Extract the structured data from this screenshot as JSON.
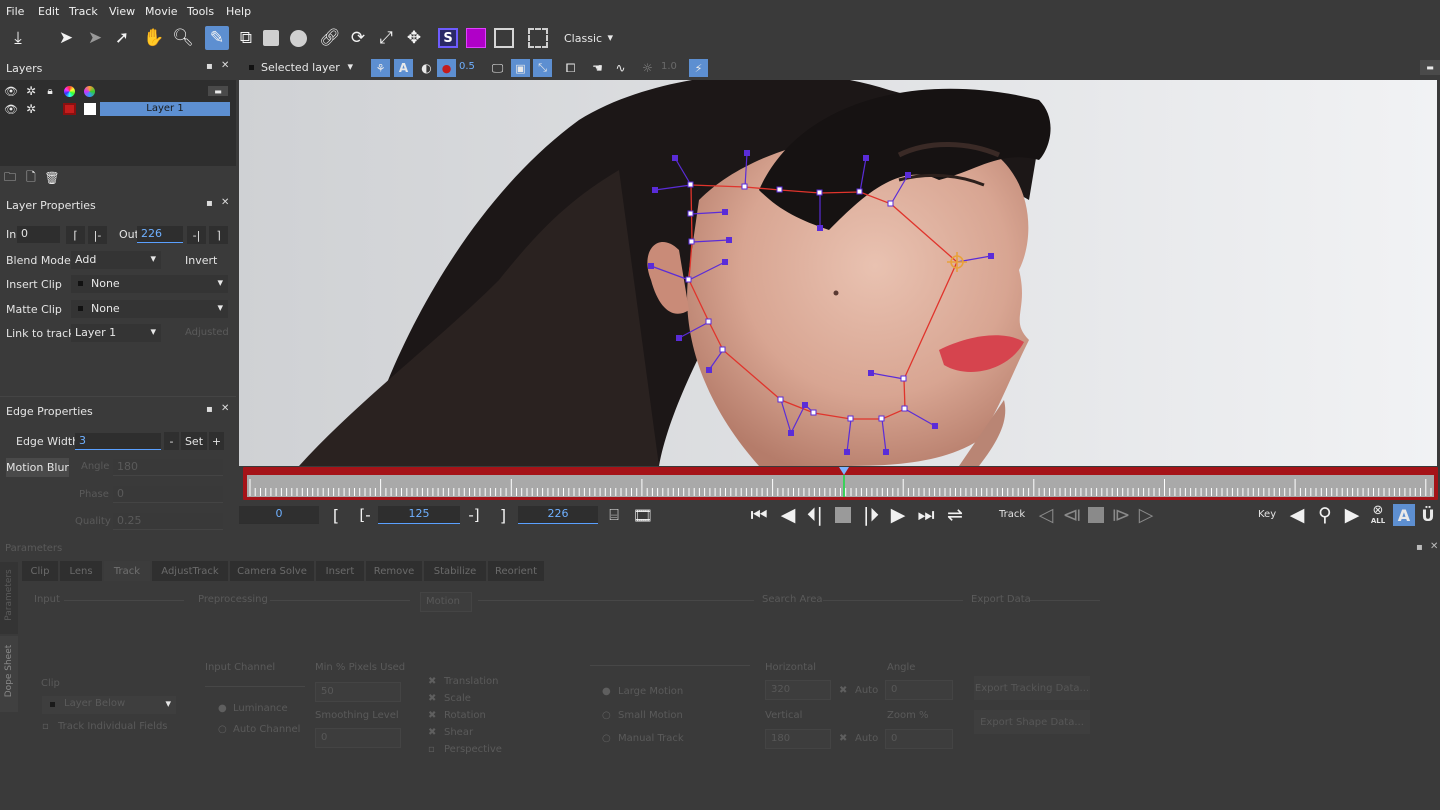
{
  "menu": [
    "File",
    "Edit",
    "Track",
    "View",
    "Movie",
    "Tools",
    "Help"
  ],
  "toolbar": {
    "classic_dropdown": "Classic",
    "selected_layer_dropdown": "Selected layer",
    "opacity_value": "0.5",
    "brightness_value": "1.0"
  },
  "layers_panel": {
    "title": "Layers",
    "layer1_name": "Layer 1"
  },
  "layer_properties": {
    "title": "Layer Properties",
    "in_label": "In",
    "in_value": "0",
    "out_label": "Out",
    "out_value": "226",
    "blend_mode_label": "Blend Mode",
    "blend_mode_value": "Add",
    "invert_label": "Invert",
    "insert_clip_label": "Insert Clip",
    "insert_clip_value": "None",
    "matte_clip_label": "Matte Clip",
    "matte_clip_value": "None",
    "link_to_track_label": "Link to track",
    "link_to_track_value": "Layer 1",
    "adjusted_label": "Adjusted"
  },
  "edge_properties": {
    "title": "Edge Properties",
    "edge_width_label": "Edge Width",
    "edge_width_value": "3",
    "minus": "-",
    "set": "Set",
    "plus": "+",
    "motion_blur_label": "Motion Blur",
    "angle_label": "Angle",
    "angle_value": "180",
    "phase_label": "Phase",
    "phase_value": "0",
    "quality_label": "Quality",
    "quality_value": "0.25"
  },
  "timeline": {
    "start_frame": "0",
    "in_frame": "125",
    "out_frame": "226",
    "playhead_fraction": 0.503,
    "track_label": "Track",
    "key_label": "Key",
    "all_label": "ALL"
  },
  "parameters": {
    "title": "Parameters",
    "side_tab_parameters": "Parameters",
    "side_tab_dope_sheet": "Dope Sheet",
    "tabs": [
      "Clip",
      "Lens",
      "Track",
      "AdjustTrack",
      "Camera Solve",
      "Insert",
      "Remove",
      "Stabilize",
      "Reorient"
    ],
    "active_tab": "Track",
    "input_header": "Input",
    "preprocessing_header": "Preprocessing",
    "motion_header": "Motion",
    "search_area_header": "Search Area",
    "export_data_header": "Export Data",
    "input_channel_label": "Input Channel",
    "luminance": "Luminance",
    "auto_channel": "Auto Channel",
    "clip_label": "Clip",
    "clip_value": "Layer Below",
    "track_individual_fields": "Track Individual Fields",
    "min_pixels_label": "Min % Pixels Used",
    "min_pixels_value": "50",
    "smoothing_label": "Smoothing Level",
    "smoothing_value": "0",
    "translation": "Translation",
    "scale": "Scale",
    "rotation": "Rotation",
    "shear": "Shear",
    "perspective": "Perspective",
    "large_motion": "Large Motion",
    "small_motion": "Small Motion",
    "manual_track": "Manual Track",
    "horizontal_label": "Horizontal",
    "horizontal_value": "320",
    "vertical_label": "Vertical",
    "vertical_value": "180",
    "auto": "Auto",
    "angle_label": "Angle",
    "angle_value": "0",
    "zoom_label": "Zoom %",
    "zoom_value": "0",
    "export_tracking_data": "Export Tracking Data...",
    "export_shape_data": "Export Shape Data..."
  },
  "colors": {
    "accent": "#5d8fd1",
    "spline": "#e0342c",
    "control_point": "#5a2cd8",
    "timeline_border": "#c4161c",
    "panel_bg": "#3a3a3a"
  }
}
